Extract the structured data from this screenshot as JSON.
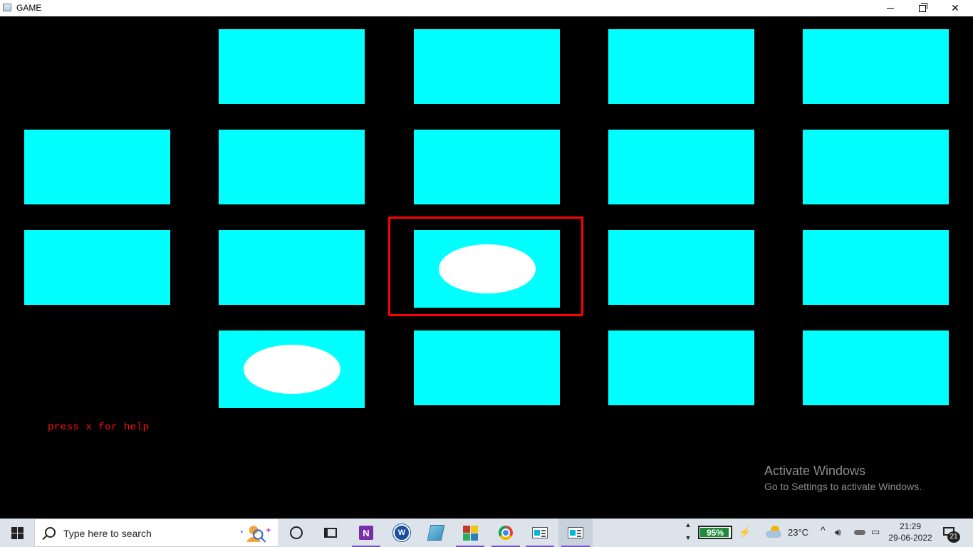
{
  "window": {
    "title": "GAME",
    "minimize_glyph": "–",
    "restore_glyph": "❐",
    "close_glyph": "✕"
  },
  "game": {
    "background": "#000000",
    "tile_color": "#00ffff",
    "card_color": "#ffffff",
    "selector_color": "#ff0000",
    "grid": {
      "rows": 4,
      "cols": 5,
      "cells": [
        [
          "empty",
          "hidden",
          "hidden",
          "hidden",
          "hidden"
        ],
        [
          "hidden",
          "hidden",
          "hidden",
          "hidden",
          "hidden"
        ],
        [
          "hidden",
          "hidden",
          "revealed",
          "hidden",
          "hidden"
        ],
        [
          "empty",
          "revealed",
          "hidden",
          "hidden",
          "hidden"
        ]
      ],
      "selected": {
        "row": 3,
        "col": 3
      }
    },
    "help_text": "press x for help",
    "help_color": "#ff1010"
  },
  "watermark": {
    "line1": "Activate Windows",
    "line2": "Go to Settings to activate Windows."
  },
  "taskbar": {
    "search_placeholder": "Type here to search",
    "apps": [
      {
        "name": "cortana-icon"
      },
      {
        "name": "task-view-icon"
      },
      {
        "name": "onenote-icon",
        "label": "N"
      },
      {
        "name": "writer-app-icon",
        "label": "W"
      },
      {
        "name": "notepad-app-icon"
      },
      {
        "name": "color-app-icon"
      },
      {
        "name": "chrome-icon"
      },
      {
        "name": "game-window-icon"
      },
      {
        "name": "game-window-active-icon"
      }
    ],
    "battery": {
      "percent_text": "95%",
      "level": 0.95
    },
    "weather": {
      "temp": "23°C"
    },
    "clock": {
      "time": "21:29",
      "date": "29-06-2022"
    },
    "notifications": {
      "count": "21"
    },
    "accent": "#7a55c8"
  }
}
